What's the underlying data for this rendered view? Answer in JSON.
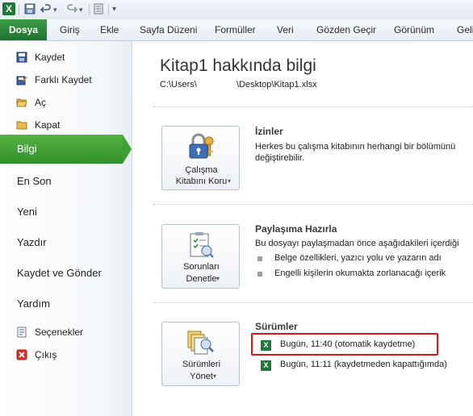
{
  "quick_access": {
    "app_icon": "excel-icon",
    "icons": [
      "save-icon",
      "undo-icon",
      "dropdown-arrow-icon",
      "redo-icon",
      "dropdown-arrow-icon",
      "form-icon",
      "customize-icon"
    ]
  },
  "ribbon": {
    "file_tab": "Dosya",
    "tabs": [
      "Giriş",
      "Ekle",
      "Sayfa Düzeni",
      "Formüller",
      "Veri",
      "Gözden Geçir",
      "Görünüm",
      "Geli"
    ]
  },
  "sidebar": {
    "small_items": [
      {
        "label": "Kaydet",
        "icon": "save-icon"
      },
      {
        "label": "Farklı Kaydet",
        "icon": "save-as-icon"
      },
      {
        "label": "Aç",
        "icon": "open-folder-icon"
      },
      {
        "label": "Kapat",
        "icon": "close-folder-icon"
      }
    ],
    "selected": "Bilgi",
    "big_items": [
      "En Son",
      "Yeni",
      "Yazdır",
      "Kaydet ve Gönder",
      "Yardım"
    ],
    "bottom_items": [
      {
        "label": "Seçenekler",
        "icon": "options-icon"
      },
      {
        "label": "Çıkış",
        "icon": "exit-icon"
      }
    ]
  },
  "info": {
    "title": "Kitap1 hakkında bilgi",
    "path_start": "C:\\Users\\",
    "path_end": "\\Desktop\\Kitap1.xlsx"
  },
  "permissions": {
    "button_line1": "Çalışma",
    "button_line2": "Kitabını Koru",
    "title": "İzinler",
    "text_line1": "Herkes bu çalışma kitabının herhangi bir bölümünü",
    "text_line2": "değiştirebilir."
  },
  "prepare": {
    "button_line1": "Sorunları",
    "button_line2": "Denetle",
    "title": "Paylaşıma Hazırla",
    "text": "Bu dosyayı paylaşmadan önce aşağıdakileri içerdiği",
    "bullets": [
      "Belge özellikleri, yazıcı yolu ve yazarın adı",
      "Engelli kişilerin okumakta zorlanacağı içerik"
    ]
  },
  "versions": {
    "button_line1": "Sürümleri",
    "button_line2": "Yönet",
    "title": "Sürümler",
    "items": [
      "Bugün, 11:40 (otomatik kaydetme)",
      "Bugün, 11:11 (kaydetmeden kapattığımda)"
    ]
  },
  "colors": {
    "accent_green": "#2f8f2a",
    "highlight_red": "#e0151a"
  }
}
